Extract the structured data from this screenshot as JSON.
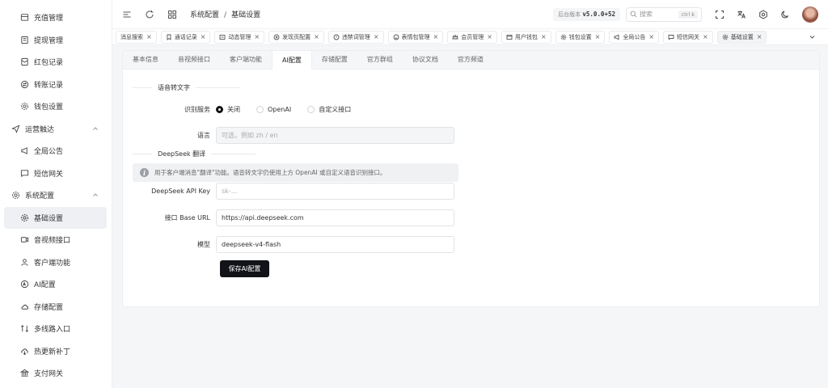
{
  "sidebar": {
    "items": [
      {
        "label": "充值管理",
        "icon": "recharge-icon"
      },
      {
        "label": "提现管理",
        "icon": "withdraw-icon"
      },
      {
        "label": "红包记录",
        "icon": "red-packet-icon"
      },
      {
        "label": "转账记录",
        "icon": "transfer-icon"
      },
      {
        "label": "钱包设置",
        "icon": "gear-icon"
      },
      {
        "label": "运营触达",
        "icon": "send-icon"
      },
      {
        "label": "全局公告",
        "icon": "megaphone-icon"
      },
      {
        "label": "短信网关",
        "icon": "message-icon"
      },
      {
        "label": "系统配置",
        "icon": "settings-icon"
      },
      {
        "label": "基础设置",
        "icon": "gear-icon"
      },
      {
        "label": "音视频接口",
        "icon": "video-icon"
      },
      {
        "label": "客户端功能",
        "icon": "user-icon"
      },
      {
        "label": "AI配置",
        "icon": "ai-icon"
      },
      {
        "label": "存储配置",
        "icon": "cloud-icon"
      },
      {
        "label": "多线路入口",
        "icon": "route-icon"
      },
      {
        "label": "热更新补丁",
        "icon": "cloud-download-icon"
      },
      {
        "label": "支付网关",
        "icon": "bank-icon"
      }
    ]
  },
  "header": {
    "breadcrumb": [
      "系统配置",
      "基础设置"
    ],
    "version_label": "后台版本",
    "version": "v5.0.0+52",
    "search_placeholder": "搜索",
    "search_shortcut": "ctrl k"
  },
  "tabs": [
    {
      "label": "消息搜索"
    },
    {
      "label": "通话记录"
    },
    {
      "label": "动态管理"
    },
    {
      "label": "发现页配置"
    },
    {
      "label": "违禁词管理"
    },
    {
      "label": "表情包管理"
    },
    {
      "label": "会员管理"
    },
    {
      "label": "用户钱包"
    },
    {
      "label": "钱包设置"
    },
    {
      "label": "全局公告"
    },
    {
      "label": "短信网关"
    },
    {
      "label": "基础设置"
    }
  ],
  "subtabs": [
    "基本信息",
    "音视频接口",
    "客户端功能",
    "AI配置",
    "存储配置",
    "官方群组",
    "协议文档",
    "官方频道"
  ],
  "form": {
    "section1": "语音转文字",
    "service_label": "识别服务",
    "service_options": [
      "关闭",
      "OpenAI",
      "自定义接口"
    ],
    "lang_label": "语言",
    "lang_placeholder": "可选，例如 zh / en",
    "section2": "DeepSeek 翻译",
    "info_text": "用于客户端消息\"翻译\"功能。语音转文字仍使用上方 OpenAI 或自定义语音识别接口。",
    "api_key_label": "DeepSeek API Key",
    "api_key_placeholder": "sk-...",
    "base_url_label": "接口 Base URL",
    "base_url_value": "https://api.deepseek.com",
    "model_label": "模型",
    "model_value": "deepseek-v4-flash",
    "save_label": "保存AI配置"
  }
}
